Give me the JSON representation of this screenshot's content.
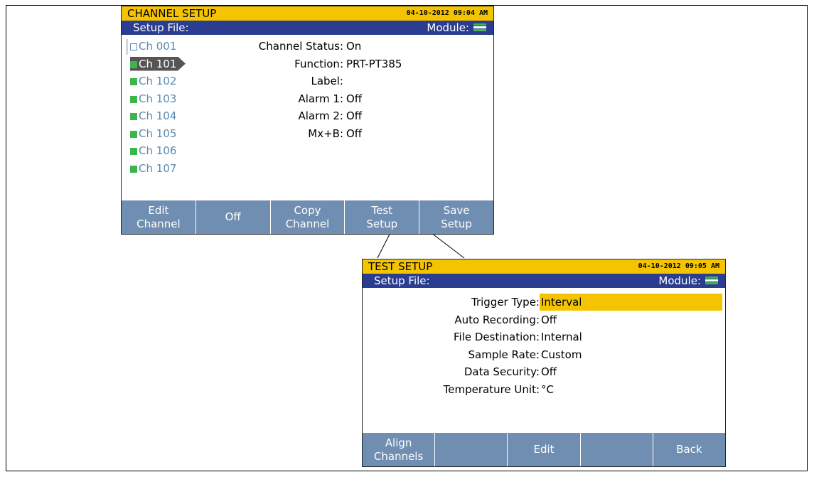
{
  "channel_setup": {
    "title": "CHANNEL SETUP",
    "timestamp": "04-10-2012 09:04 AM",
    "setup_file_label": "Setup File:",
    "module_label": "Module:",
    "channels": [
      {
        "label": "Ch 001",
        "enabled": false
      },
      {
        "label": "Ch 101",
        "enabled": true,
        "selected": true
      },
      {
        "label": "Ch 102",
        "enabled": true
      },
      {
        "label": "Ch 103",
        "enabled": true
      },
      {
        "label": "Ch 104",
        "enabled": true
      },
      {
        "label": "Ch 105",
        "enabled": true
      },
      {
        "label": "Ch 106",
        "enabled": true
      },
      {
        "label": "Ch 107",
        "enabled": true
      }
    ],
    "fields": [
      {
        "key": "Channel Status:",
        "value": "On"
      },
      {
        "key": "Function:",
        "value": "PRT-PT385"
      },
      {
        "key": "Label:",
        "value": ""
      },
      {
        "key": "Alarm 1:",
        "value": "Off"
      },
      {
        "key": "Alarm 2:",
        "value": "Off"
      },
      {
        "key": "Mx+B:",
        "value": "Off"
      }
    ],
    "softkeys": [
      "Edit\nChannel",
      "Off",
      "Copy\nChannel",
      "Test\nSetup",
      "Save\nSetup"
    ]
  },
  "test_setup": {
    "title": "TEST SETUP",
    "timestamp": "04-10-2012 09:05 AM",
    "setup_file_label": "Setup File:",
    "module_label": "Module:",
    "fields": [
      {
        "key": "Trigger Type:",
        "value": "Interval"
      },
      {
        "key": "Auto Recording:",
        "value": "Off"
      },
      {
        "key": "File Destination:",
        "value": "Internal"
      },
      {
        "key": "Sample Rate:",
        "value": "Custom"
      },
      {
        "key": "Data Security:",
        "value": "Off"
      },
      {
        "key": "Temperature Unit:",
        "value": "°C"
      }
    ],
    "softkeys": [
      "Align\nChannels",
      "",
      "Edit",
      "",
      "Back"
    ]
  },
  "colors": {
    "title_bar": "#f5c400",
    "sub_bar": "#2b3d90",
    "softkey": "#6f8eb1",
    "channel_on": "#3cb54a",
    "channel_text": "#5a8ab0"
  }
}
